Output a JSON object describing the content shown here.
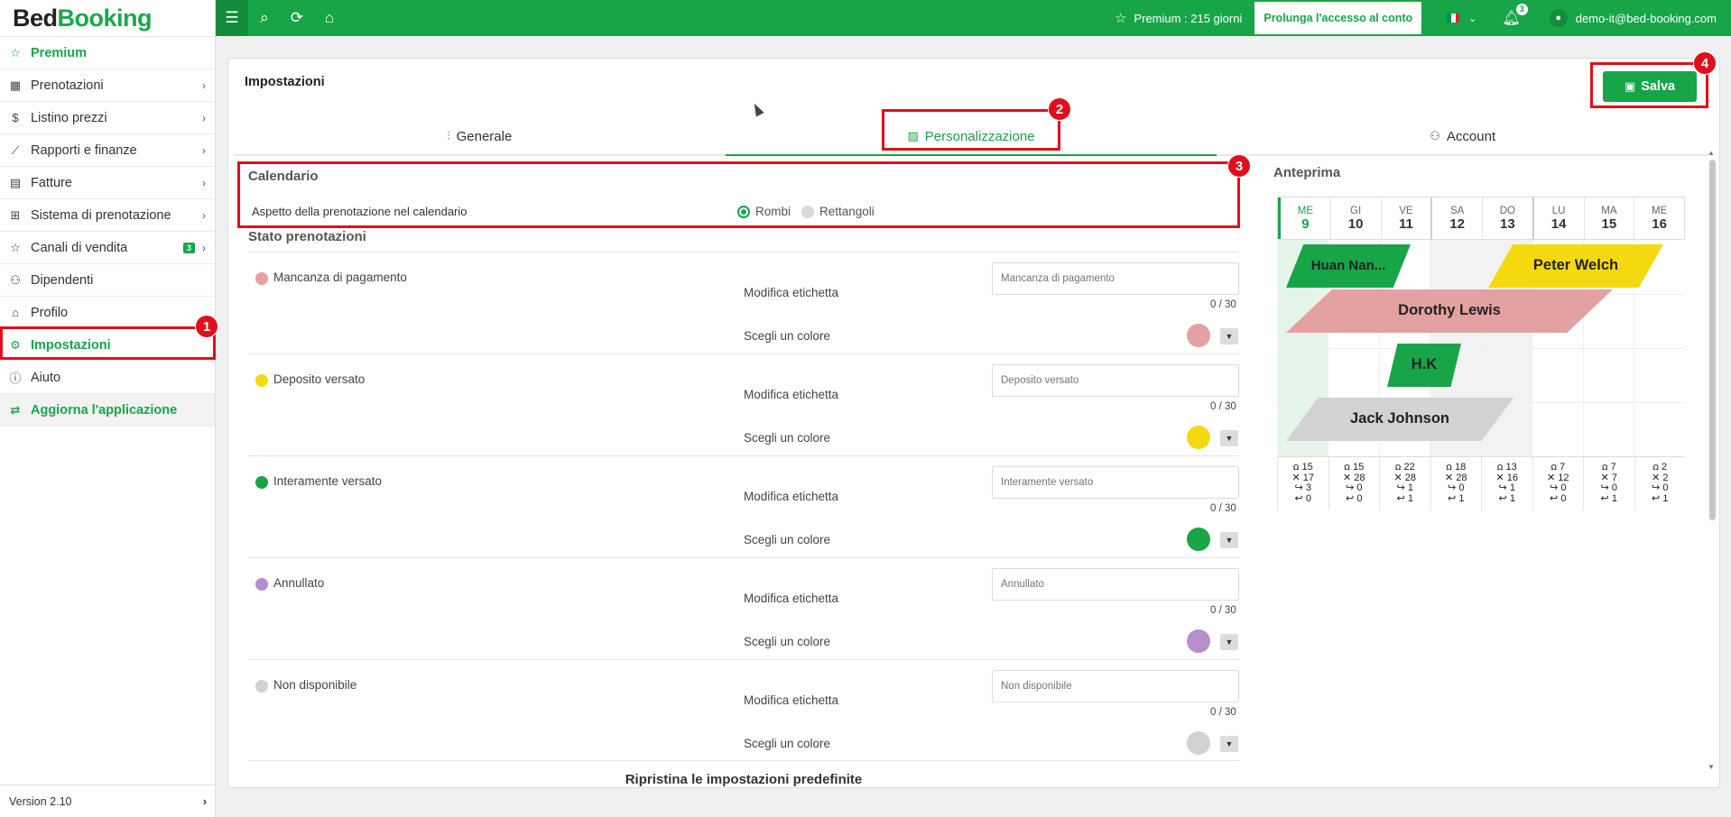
{
  "brand": {
    "part1": "Bed",
    "part2": "Booking"
  },
  "sidebar": {
    "items": [
      {
        "label": "Premium",
        "icon": "star-icon",
        "chevron": false
      },
      {
        "label": "Prenotazioni",
        "icon": "calendar-icon",
        "chevron": true
      },
      {
        "label": "Listino prezzi",
        "icon": "dollar-icon",
        "chevron": true
      },
      {
        "label": "Rapporti e finanze",
        "icon": "chart-icon",
        "chevron": true
      },
      {
        "label": "Fatture",
        "icon": "invoice-icon",
        "chevron": true
      },
      {
        "label": "Sistema di prenotazione",
        "icon": "grid-icon",
        "chevron": true
      },
      {
        "label": "Canali di vendita",
        "icon": "star-icon",
        "chevron": true,
        "badge": "3"
      },
      {
        "label": "Dipendenti",
        "icon": "users-icon",
        "chevron": false
      },
      {
        "label": "Profilo",
        "icon": "building-icon",
        "chevron": false
      },
      {
        "label": "Impostazioni",
        "icon": "gear-icon",
        "chevron": false
      },
      {
        "label": "Aiuto",
        "icon": "info-icon",
        "chevron": false
      },
      {
        "label": "Aggiorna l'applicazione",
        "icon": "refresh-icon",
        "chevron": false
      }
    ],
    "version": "Version 2.10"
  },
  "topbar": {
    "premium": "Premium : 215 giorni",
    "extend_button": "Prolunga l'accesso al conto",
    "notifications_count": "3",
    "user_email": "demo-it@bed-booking.com"
  },
  "page": {
    "title": "Impostazioni",
    "save_label": "Salva",
    "tabs": [
      "Generale",
      "Personalizzazione",
      "Account"
    ],
    "calendar": {
      "title": "Calendario",
      "label": "Aspetto della prenotazione nel calendario",
      "option_on": "Rombi",
      "option_off": "Rettangoli"
    },
    "status_title": "Stato prenotazioni",
    "edit_label": "Modifica etichetta",
    "color_label": "Scegli un colore",
    "counter": "0 / 30",
    "statuses": [
      {
        "name": "Mancanza di pagamento",
        "placeholder": "Mancanza di pagamento",
        "color": "#e4a1a1"
      },
      {
        "name": "Deposito versato",
        "placeholder": "Deposito versato",
        "color": "#f5d90f"
      },
      {
        "name": "Interamente versato",
        "placeholder": "Interamente versato",
        "color": "#17a548"
      },
      {
        "name": "Annullato",
        "placeholder": "Annullato",
        "color": "#b48fcc"
      },
      {
        "name": "Non disponibile",
        "placeholder": "Non disponibile",
        "color": "#d2d2d2"
      }
    ],
    "reset_label": "Ripristina le impostazioni predefinite"
  },
  "preview": {
    "title": "Anteprima",
    "days": [
      {
        "dn": "ME",
        "dd": "9"
      },
      {
        "dn": "GI",
        "dd": "10"
      },
      {
        "dn": "VE",
        "dd": "11"
      },
      {
        "dn": "SA",
        "dd": "12"
      },
      {
        "dn": "DO",
        "dd": "13"
      },
      {
        "dn": "LU",
        "dd": "14"
      },
      {
        "dn": "MA",
        "dd": "15"
      },
      {
        "dn": "ME",
        "dd": "16"
      }
    ],
    "bookings": [
      {
        "name": "Huan Nan...",
        "color": "#17a548"
      },
      {
        "name": "Peter Welch",
        "color": "#f5d90f"
      },
      {
        "name": "Dorothy Lewis",
        "color": "#e4a1a1"
      },
      {
        "name": "H.K",
        "color": "#17a548"
      },
      {
        "name": "Jack Johnson",
        "color": "#d2d2d2"
      }
    ],
    "stats": [
      [
        "15",
        "17",
        "3",
        "0"
      ],
      [
        "15",
        "28",
        "0",
        "0"
      ],
      [
        "22",
        "28",
        "1",
        "1"
      ],
      [
        "18",
        "28",
        "0",
        "1"
      ],
      [
        "13",
        "16",
        "1",
        "1"
      ],
      [
        "7",
        "12",
        "0",
        "0"
      ],
      [
        "7",
        "7",
        "0",
        "1"
      ],
      [
        "2",
        "2",
        "0",
        "1"
      ]
    ]
  },
  "annotations": [
    "1",
    "2",
    "3",
    "4"
  ]
}
